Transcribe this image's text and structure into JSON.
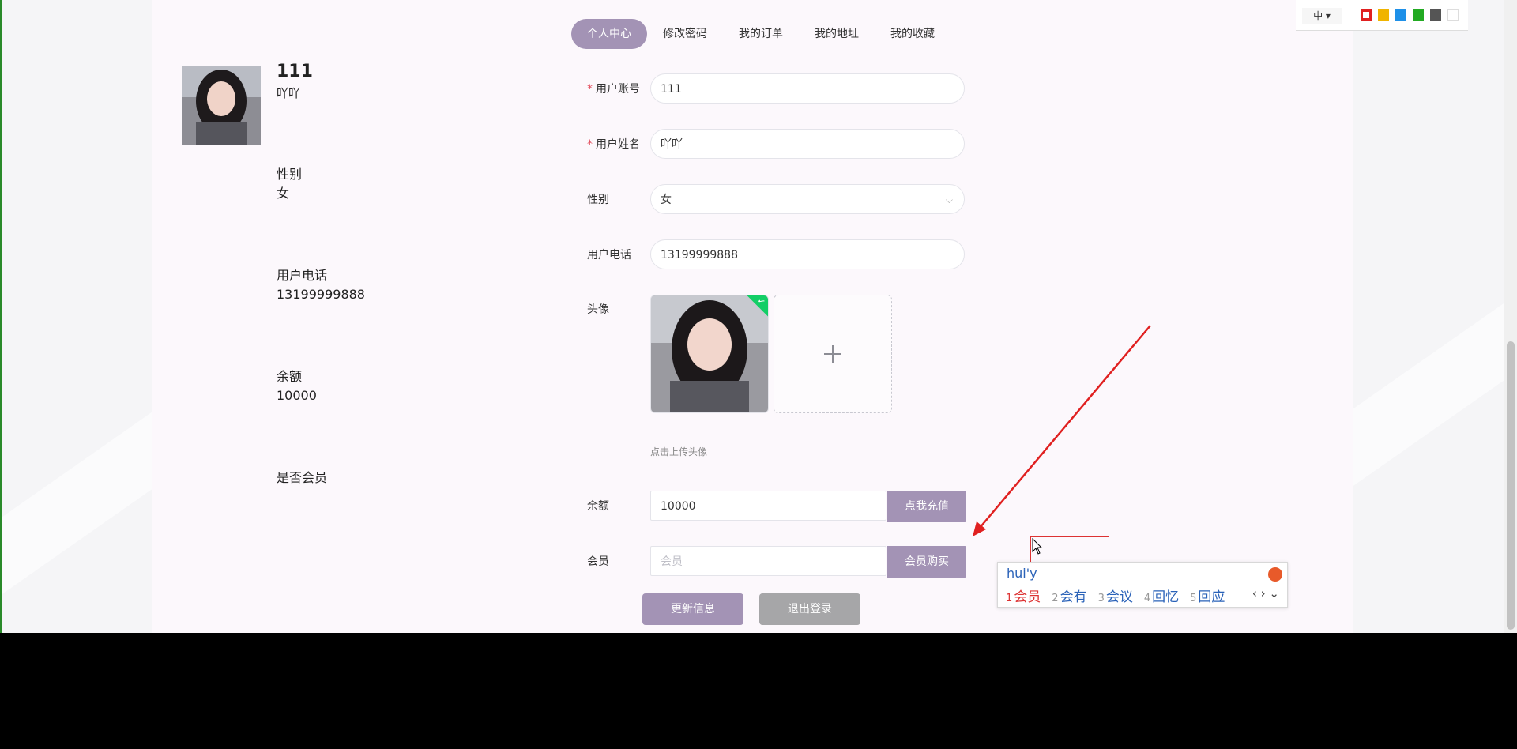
{
  "tabs": [
    "个人中心",
    "修改密码",
    "我的订单",
    "我的地址",
    "我的收藏"
  ],
  "profile": {
    "username": "111",
    "nickname": "吖吖",
    "gender_label": "性别",
    "gender": "女",
    "phone_label": "用户电话",
    "phone": "13199999888",
    "balance_label": "余额",
    "balance": "10000",
    "member_label": "是否会员"
  },
  "form": {
    "account_label": "用户账号",
    "account_value": "111",
    "name_label": "用户姓名",
    "name_value": "吖吖",
    "gender_label": "性别",
    "gender_value": "女",
    "phone_label": "用户电话",
    "phone_value": "13199999888",
    "avatar_label": "头像",
    "upload_tip": "点击上传头像",
    "balance_label": "余额",
    "balance_value": "10000",
    "recharge_button": "点我充值",
    "member_label": "会员",
    "member_placeholder": "会员",
    "buy_member_button": "会员购买",
    "update_button": "更新信息",
    "logout_button": "退出登录"
  },
  "theme_picker": {
    "lang": "中",
    "swatches": [
      "#e02020",
      "#f0b400",
      "#1e90e8",
      "#22aa22",
      "#555555",
      "#ffffff"
    ]
  },
  "ime": {
    "input": "hui'y",
    "candidates": [
      {
        "n": "1",
        "text": "会员"
      },
      {
        "n": "2",
        "text": "会有"
      },
      {
        "n": "3",
        "text": "会议"
      },
      {
        "n": "4",
        "text": "回忆"
      },
      {
        "n": "5",
        "text": "回应"
      }
    ]
  },
  "colors": {
    "accent": "#a393b5",
    "annotation": "#e02020"
  }
}
